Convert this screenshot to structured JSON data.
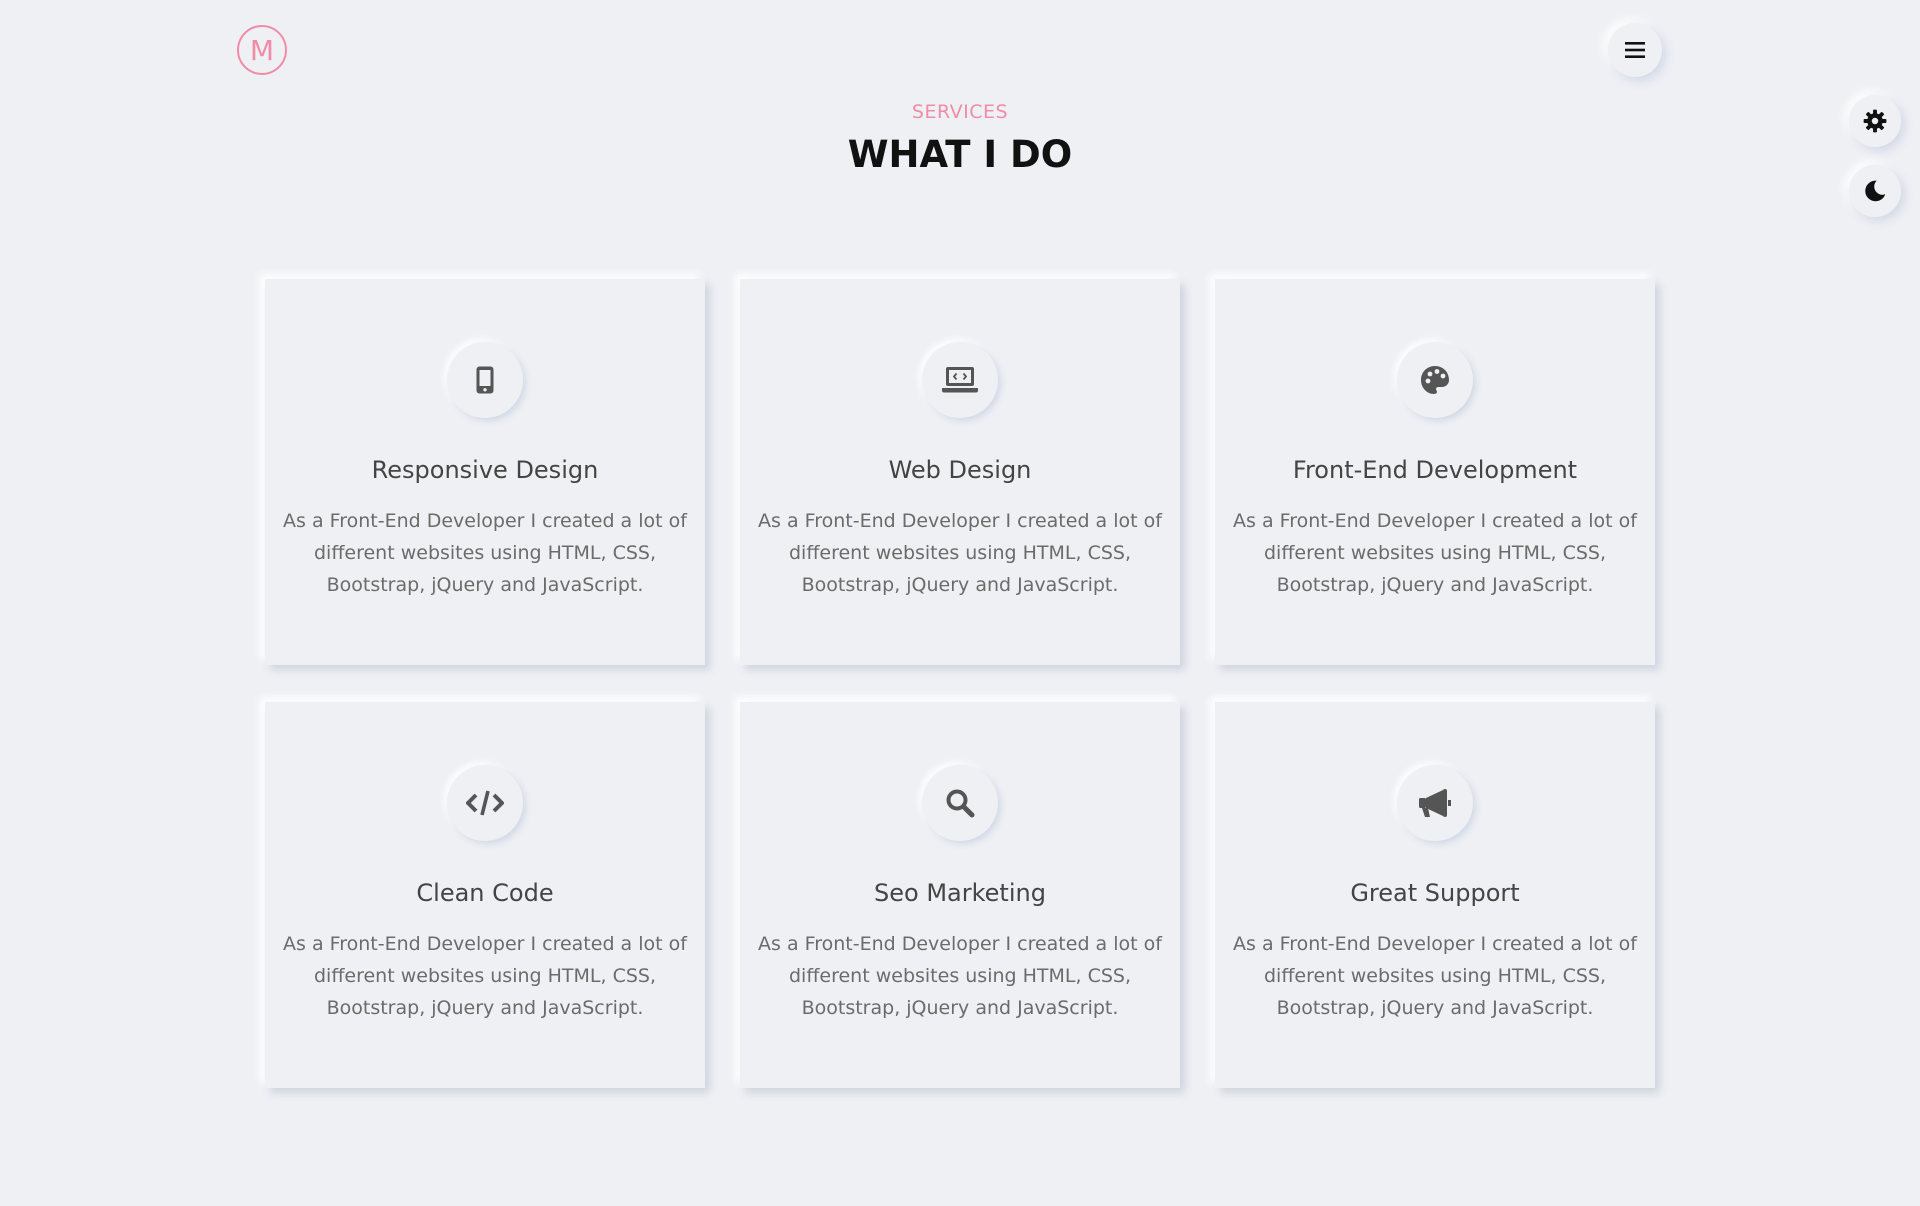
{
  "header": {
    "logo_letter": "M"
  },
  "section": {
    "subtitle": "SERVICES",
    "title": "WHAT I DO"
  },
  "colors": {
    "accent": "#f08ca7",
    "background": "#eff0f4",
    "icon": "#555555"
  },
  "services": [
    {
      "icon": "mobile-icon",
      "title": "Responsive Design",
      "text": "As a Front-End Developer I created a lot of different websites using HTML, CSS, Bootstrap, jQuery and JavaScript."
    },
    {
      "icon": "laptop-code-icon",
      "title": "Web Design",
      "text": "As a Front-End Developer I created a lot of different websites using HTML, CSS, Bootstrap, jQuery and JavaScript."
    },
    {
      "icon": "palette-icon",
      "title": "Front-End Development",
      "text": "As a Front-End Developer I created a lot of different websites using HTML, CSS, Bootstrap, jQuery and JavaScript."
    },
    {
      "icon": "code-icon",
      "title": "Clean Code",
      "text": "As a Front-End Developer I created a lot of different websites using HTML, CSS, Bootstrap, jQuery and JavaScript."
    },
    {
      "icon": "search-icon",
      "title": "Seo Marketing",
      "text": "As a Front-End Developer I created a lot of different websites using HTML, CSS, Bootstrap, jQuery and JavaScript."
    },
    {
      "icon": "megaphone-icon",
      "title": "Great Support",
      "text": "As a Front-End Developer I created a lot of different websites using HTML, CSS, Bootstrap, jQuery and JavaScript."
    }
  ]
}
